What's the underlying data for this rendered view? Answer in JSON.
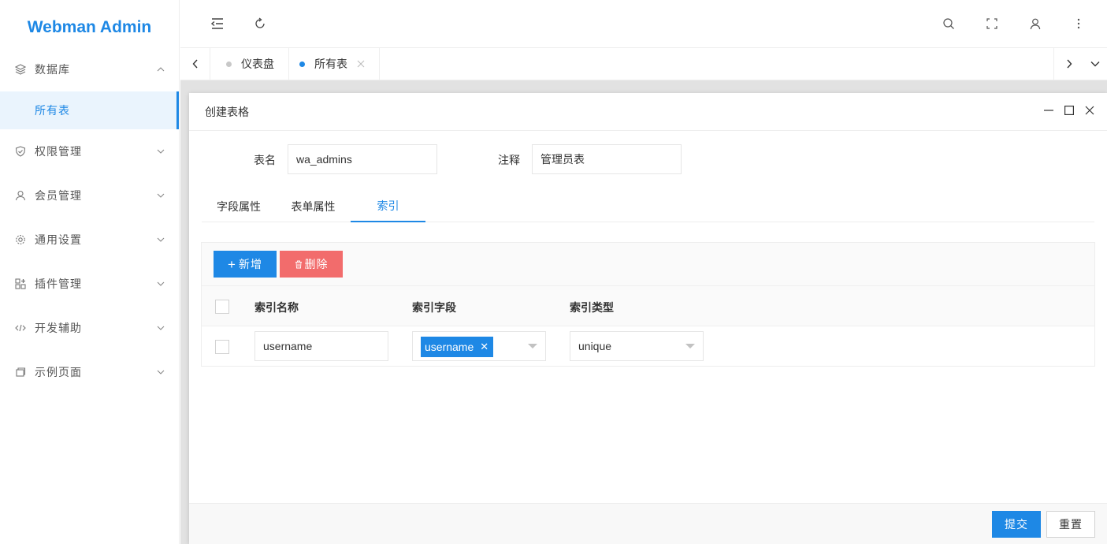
{
  "app": {
    "logo": "Webman Admin"
  },
  "sidebar": {
    "items": [
      {
        "label": "数据库",
        "icon": "layers-icon",
        "expanded": true
      },
      {
        "label": "权限管理",
        "icon": "shield-icon"
      },
      {
        "label": "会员管理",
        "icon": "user-icon"
      },
      {
        "label": "通用设置",
        "icon": "gear-icon"
      },
      {
        "label": "插件管理",
        "icon": "apps-icon"
      },
      {
        "label": "开发辅助",
        "icon": "code-icon"
      },
      {
        "label": "示例页面",
        "icon": "page-icon"
      }
    ],
    "active_sub": "所有表"
  },
  "header": {
    "icons": [
      "menu-fold-icon",
      "refresh-icon",
      "search-icon",
      "fullscreen-icon",
      "user-icon",
      "more-vertical-icon"
    ]
  },
  "tabsbar": {
    "tabs": [
      {
        "label": "仪表盘",
        "active": false
      },
      {
        "label": "所有表",
        "active": true
      }
    ]
  },
  "dialog": {
    "title": "创建表格",
    "form": {
      "table_name_label": "表名",
      "table_name_value": "wa_admins",
      "comment_label": "注释",
      "comment_value": "管理员表"
    },
    "tabs": [
      {
        "label": "字段属性",
        "active": false
      },
      {
        "label": "表单属性",
        "active": false
      },
      {
        "label": "索引",
        "active": true
      }
    ],
    "toolbar": {
      "add_label": "新增",
      "delete_label": "删除"
    },
    "table": {
      "columns": [
        "索引名称",
        "索引字段",
        "索引类型"
      ],
      "rows": [
        {
          "name": "username",
          "field_tag": "username",
          "type": "unique"
        }
      ]
    },
    "footer": {
      "submit_label": "提交",
      "reset_label": "重置"
    }
  },
  "colors": {
    "primary": "#1e88e5",
    "danger": "#f26c6c",
    "content_bg": "#e2e2e2"
  }
}
